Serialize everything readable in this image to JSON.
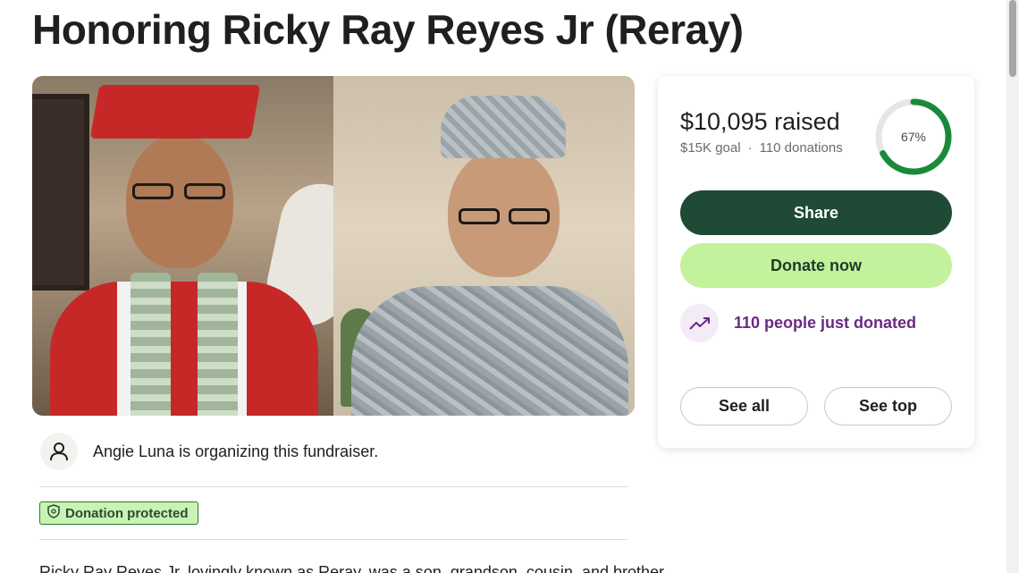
{
  "page": {
    "title": "Honoring Ricky Ray Reyes Jr (Reray)"
  },
  "organizer": {
    "text": "Angie Luna is organizing this fundraiser.",
    "avatar_icon": "person-icon"
  },
  "badge": {
    "label": "Donation protected",
    "icon": "shield-icon"
  },
  "story": {
    "first_line": "Ricky Ray Reyes Jr, lovingly known as Reray, was a son, grandson, cousin, and brother"
  },
  "donation_card": {
    "raised": "$10,095 raised",
    "goal": "$15K goal",
    "separator": "·",
    "donations": "110 donations",
    "progress_label": "67%",
    "progress_fraction": 0.67,
    "share_label": "Share",
    "donate_label": "Donate now",
    "recent_text": "110 people just donated",
    "recent_icon": "trending-up-icon",
    "see_all_label": "See all",
    "see_top_label": "See top"
  },
  "colors": {
    "progress_fill": "#1a8a3a",
    "progress_track": "#e6e6e6",
    "share_bg": "#1f4a35",
    "donate_bg": "#c2f29c",
    "recent_text": "#6a2a82",
    "badge_bg": "#c9f2b6"
  }
}
